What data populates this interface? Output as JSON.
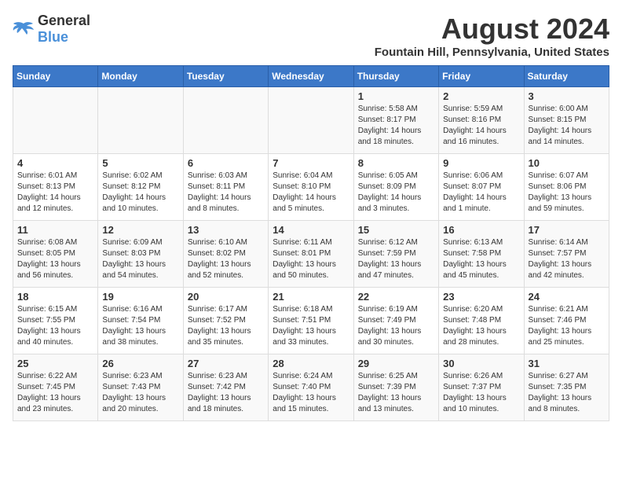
{
  "logo": {
    "general": "General",
    "blue": "Blue"
  },
  "title": {
    "month_year": "August 2024",
    "location": "Fountain Hill, Pennsylvania, United States"
  },
  "calendar": {
    "headers": [
      "Sunday",
      "Monday",
      "Tuesday",
      "Wednesday",
      "Thursday",
      "Friday",
      "Saturday"
    ],
    "weeks": [
      [
        {
          "day": "",
          "info": ""
        },
        {
          "day": "",
          "info": ""
        },
        {
          "day": "",
          "info": ""
        },
        {
          "day": "",
          "info": ""
        },
        {
          "day": "1",
          "info": "Sunrise: 5:58 AM\nSunset: 8:17 PM\nDaylight: 14 hours\nand 18 minutes."
        },
        {
          "day": "2",
          "info": "Sunrise: 5:59 AM\nSunset: 8:16 PM\nDaylight: 14 hours\nand 16 minutes."
        },
        {
          "day": "3",
          "info": "Sunrise: 6:00 AM\nSunset: 8:15 PM\nDaylight: 14 hours\nand 14 minutes."
        }
      ],
      [
        {
          "day": "4",
          "info": "Sunrise: 6:01 AM\nSunset: 8:13 PM\nDaylight: 14 hours\nand 12 minutes."
        },
        {
          "day": "5",
          "info": "Sunrise: 6:02 AM\nSunset: 8:12 PM\nDaylight: 14 hours\nand 10 minutes."
        },
        {
          "day": "6",
          "info": "Sunrise: 6:03 AM\nSunset: 8:11 PM\nDaylight: 14 hours\nand 8 minutes."
        },
        {
          "day": "7",
          "info": "Sunrise: 6:04 AM\nSunset: 8:10 PM\nDaylight: 14 hours\nand 5 minutes."
        },
        {
          "day": "8",
          "info": "Sunrise: 6:05 AM\nSunset: 8:09 PM\nDaylight: 14 hours\nand 3 minutes."
        },
        {
          "day": "9",
          "info": "Sunrise: 6:06 AM\nSunset: 8:07 PM\nDaylight: 14 hours\nand 1 minute."
        },
        {
          "day": "10",
          "info": "Sunrise: 6:07 AM\nSunset: 8:06 PM\nDaylight: 13 hours\nand 59 minutes."
        }
      ],
      [
        {
          "day": "11",
          "info": "Sunrise: 6:08 AM\nSunset: 8:05 PM\nDaylight: 13 hours\nand 56 minutes."
        },
        {
          "day": "12",
          "info": "Sunrise: 6:09 AM\nSunset: 8:03 PM\nDaylight: 13 hours\nand 54 minutes."
        },
        {
          "day": "13",
          "info": "Sunrise: 6:10 AM\nSunset: 8:02 PM\nDaylight: 13 hours\nand 52 minutes."
        },
        {
          "day": "14",
          "info": "Sunrise: 6:11 AM\nSunset: 8:01 PM\nDaylight: 13 hours\nand 50 minutes."
        },
        {
          "day": "15",
          "info": "Sunrise: 6:12 AM\nSunset: 7:59 PM\nDaylight: 13 hours\nand 47 minutes."
        },
        {
          "day": "16",
          "info": "Sunrise: 6:13 AM\nSunset: 7:58 PM\nDaylight: 13 hours\nand 45 minutes."
        },
        {
          "day": "17",
          "info": "Sunrise: 6:14 AM\nSunset: 7:57 PM\nDaylight: 13 hours\nand 42 minutes."
        }
      ],
      [
        {
          "day": "18",
          "info": "Sunrise: 6:15 AM\nSunset: 7:55 PM\nDaylight: 13 hours\nand 40 minutes."
        },
        {
          "day": "19",
          "info": "Sunrise: 6:16 AM\nSunset: 7:54 PM\nDaylight: 13 hours\nand 38 minutes."
        },
        {
          "day": "20",
          "info": "Sunrise: 6:17 AM\nSunset: 7:52 PM\nDaylight: 13 hours\nand 35 minutes."
        },
        {
          "day": "21",
          "info": "Sunrise: 6:18 AM\nSunset: 7:51 PM\nDaylight: 13 hours\nand 33 minutes."
        },
        {
          "day": "22",
          "info": "Sunrise: 6:19 AM\nSunset: 7:49 PM\nDaylight: 13 hours\nand 30 minutes."
        },
        {
          "day": "23",
          "info": "Sunrise: 6:20 AM\nSunset: 7:48 PM\nDaylight: 13 hours\nand 28 minutes."
        },
        {
          "day": "24",
          "info": "Sunrise: 6:21 AM\nSunset: 7:46 PM\nDaylight: 13 hours\nand 25 minutes."
        }
      ],
      [
        {
          "day": "25",
          "info": "Sunrise: 6:22 AM\nSunset: 7:45 PM\nDaylight: 13 hours\nand 23 minutes."
        },
        {
          "day": "26",
          "info": "Sunrise: 6:23 AM\nSunset: 7:43 PM\nDaylight: 13 hours\nand 20 minutes."
        },
        {
          "day": "27",
          "info": "Sunrise: 6:23 AM\nSunset: 7:42 PM\nDaylight: 13 hours\nand 18 minutes."
        },
        {
          "day": "28",
          "info": "Sunrise: 6:24 AM\nSunset: 7:40 PM\nDaylight: 13 hours\nand 15 minutes."
        },
        {
          "day": "29",
          "info": "Sunrise: 6:25 AM\nSunset: 7:39 PM\nDaylight: 13 hours\nand 13 minutes."
        },
        {
          "day": "30",
          "info": "Sunrise: 6:26 AM\nSunset: 7:37 PM\nDaylight: 13 hours\nand 10 minutes."
        },
        {
          "day": "31",
          "info": "Sunrise: 6:27 AM\nSunset: 7:35 PM\nDaylight: 13 hours\nand 8 minutes."
        }
      ]
    ]
  }
}
